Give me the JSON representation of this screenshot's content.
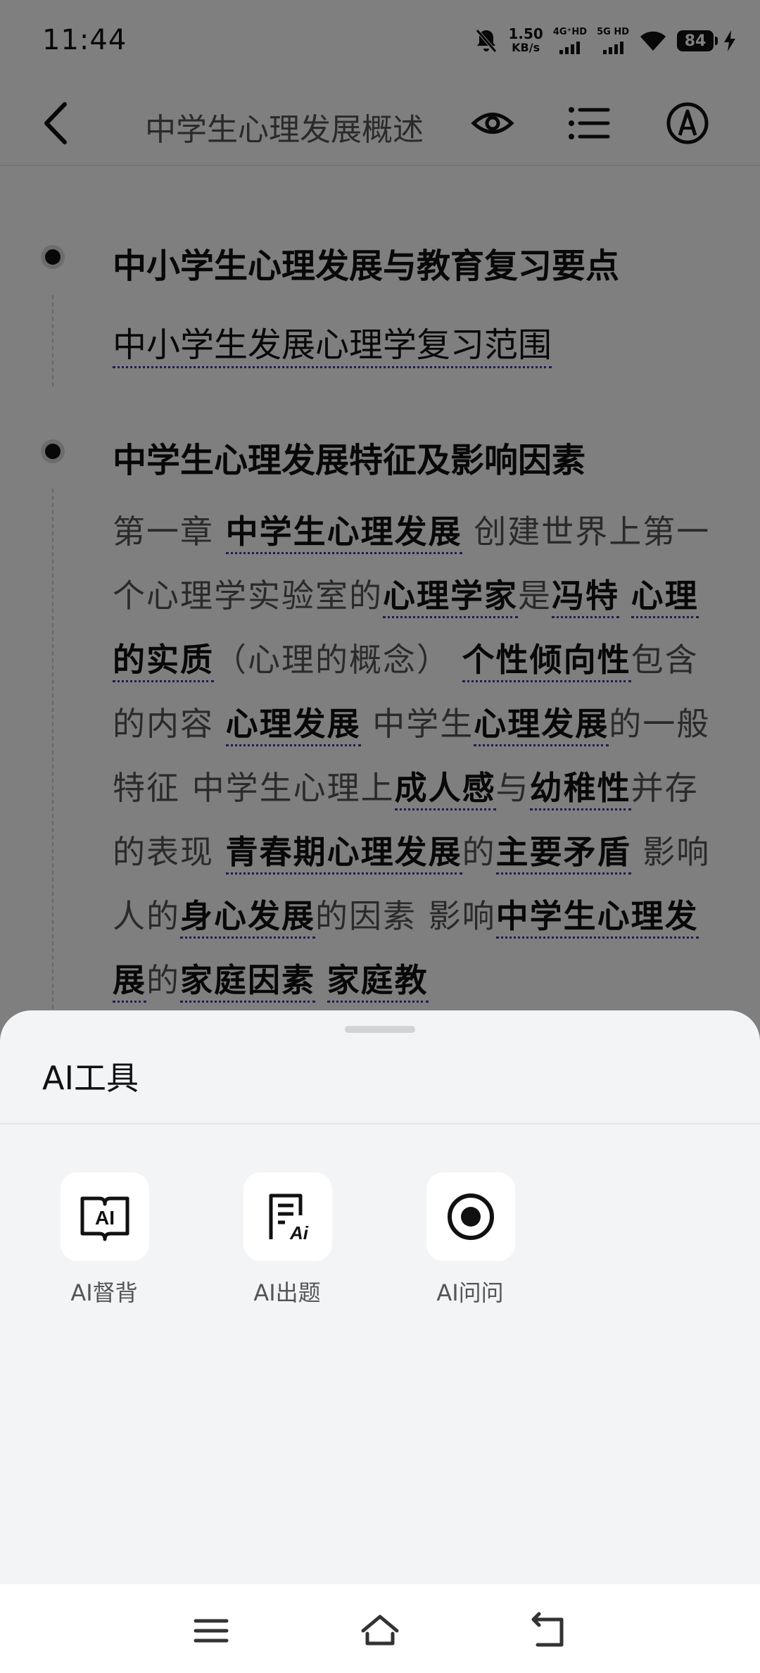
{
  "status": {
    "time": "11:44",
    "net_speed_value": "1.50",
    "net_speed_unit": "KB/s",
    "net1": "4G⁺HD",
    "net2": "5G HD",
    "battery": "84"
  },
  "header": {
    "title": "中学生心理发展概述"
  },
  "sections": [
    {
      "title": "中小学生心理发展与教育复习要点",
      "link": "中小学生发展心理学复习范围"
    },
    {
      "title": "中学生心理发展特征及影响因素",
      "segments": [
        {
          "t": "第一章 ",
          "k": 0
        },
        {
          "t": "中学生心理发展",
          "k": 1
        },
        {
          "t": " 创建世界上第一个心理学实验室的",
          "k": 0
        },
        {
          "t": "心理学家",
          "k": 1
        },
        {
          "t": "是",
          "k": 0
        },
        {
          "t": "冯特",
          "k": 1
        },
        {
          "t": " ",
          "k": 0
        },
        {
          "t": "心理的实质",
          "k": 1
        },
        {
          "t": "（心理的概念） ",
          "k": 0
        },
        {
          "t": "个性倾向性",
          "k": 1
        },
        {
          "t": "包含的内容 ",
          "k": 0
        },
        {
          "t": "心理发展",
          "k": 1
        },
        {
          "t": " 中学生",
          "k": 0
        },
        {
          "t": "心理发展",
          "k": 1
        },
        {
          "t": "的一般特征 中学生心理上",
          "k": 0
        },
        {
          "t": "成人感",
          "k": 1
        },
        {
          "t": "与",
          "k": 0
        },
        {
          "t": "幼稚性",
          "k": 1
        },
        {
          "t": "并存的表现 ",
          "k": 0
        },
        {
          "t": "青春期心理发展",
          "k": 1
        },
        {
          "t": "的",
          "k": 0
        },
        {
          "t": "主要矛盾",
          "k": 1
        },
        {
          "t": " 影响人的",
          "k": 0
        },
        {
          "t": "身心发展",
          "k": 1
        },
        {
          "t": "的因素 影响",
          "k": 0
        },
        {
          "t": "中学生心理发展",
          "k": 1
        },
        {
          "t": "的",
          "k": 0
        },
        {
          "t": "家庭因素",
          "k": 1
        },
        {
          "t": " ",
          "k": 0
        },
        {
          "t": "家庭教",
          "k": 1
        }
      ]
    }
  ],
  "sheet": {
    "title": "AI工具",
    "tools": [
      {
        "label": "AI督背",
        "icon": "ai-book-icon",
        "glyph": "AI"
      },
      {
        "label": "AI出题",
        "icon": "ai-question-icon",
        "glyph": "Ai"
      },
      {
        "label": "AI问问",
        "icon": "ai-ask-icon"
      }
    ]
  },
  "colors": {
    "overlay": "rgba(0,0,0,0.5)",
    "sheet_bg": "#f3f4f6",
    "keyword_underline": "#3a3aa8"
  }
}
